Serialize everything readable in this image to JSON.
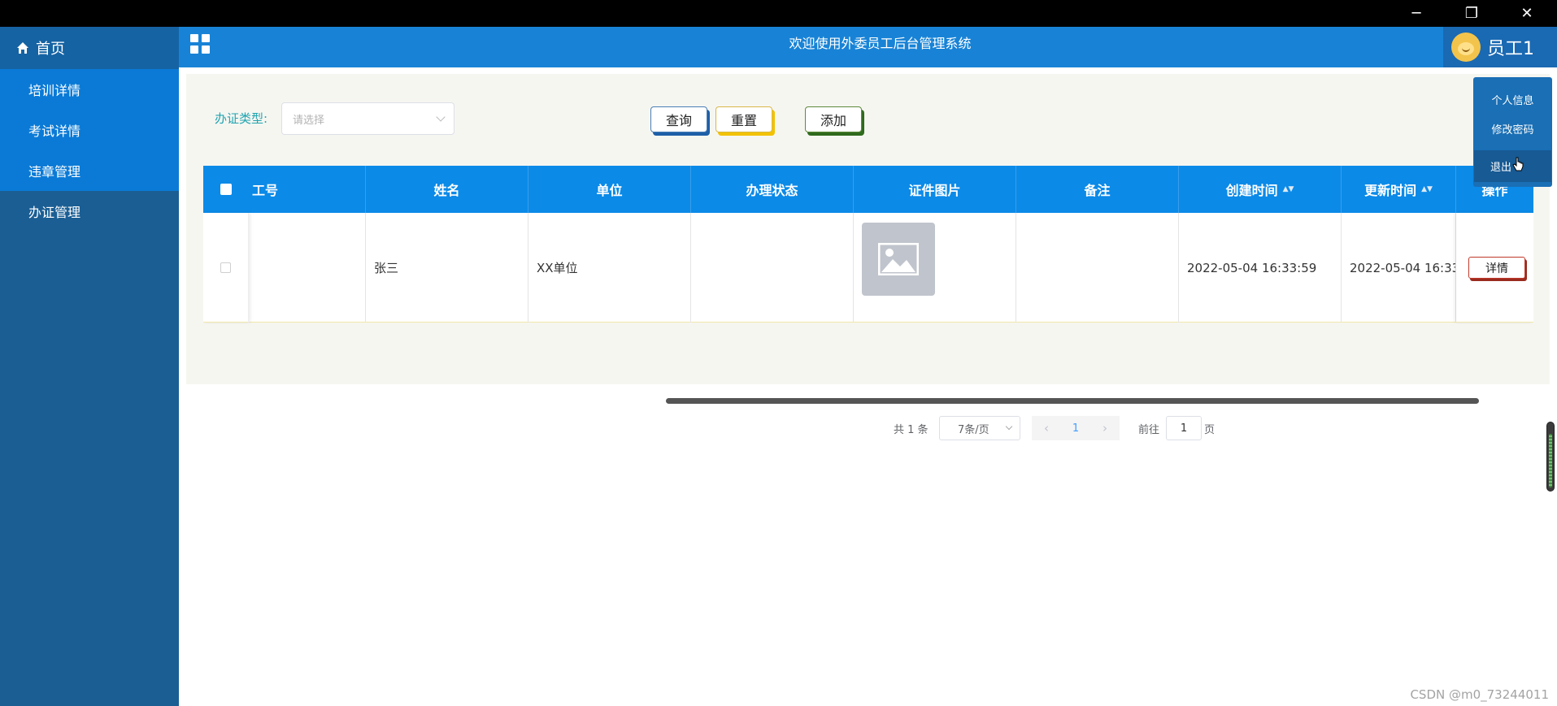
{
  "window": {
    "minimize_label": "─",
    "restore_label": "❐",
    "close_label": "✕"
  },
  "sidebar": {
    "home_label": "首页",
    "items": [
      {
        "label": "培训详情"
      },
      {
        "label": "考试详情"
      },
      {
        "label": "违章管理"
      },
      {
        "label": "办证管理"
      }
    ]
  },
  "header": {
    "title": "欢迎使用外委员工后台管理系统",
    "username": "员工1"
  },
  "user_menu": {
    "items": [
      "个人信息",
      "修改密码",
      "退出"
    ]
  },
  "filter": {
    "label": "办证类型:",
    "placeholder": "请选择"
  },
  "toolbar": {
    "query_label": "查询",
    "reset_label": "重置",
    "add_label": "添加"
  },
  "table": {
    "columns": [
      "工号",
      "姓名",
      "单位",
      "办理状态",
      "证件图片",
      "备注",
      "创建时间",
      "更新时间",
      "操作"
    ],
    "sort_glyph": "▲▼",
    "rows": [
      {
        "id": "",
        "name": "张三",
        "unit": "XX单位",
        "status": "",
        "remark": "",
        "created": "2022-05-04 16:33:59",
        "updated": "2022-05-04 16:33:",
        "action": "详情"
      }
    ]
  },
  "pagination": {
    "total": "共 1 条",
    "page_size": "7条/页",
    "prev": "‹",
    "current": "1",
    "next": "›",
    "goto_label": "前往",
    "goto_value": "1",
    "page_suffix": "页"
  },
  "watermark": "CSDN @m0_73244011"
}
